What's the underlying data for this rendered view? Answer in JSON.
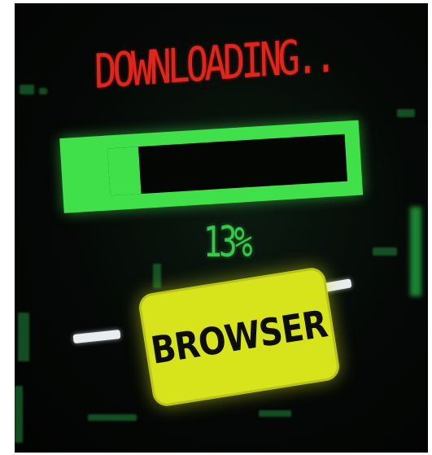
{
  "title": "DOWNLOADING..",
  "progress": {
    "fraction": 0.13,
    "label": "13%"
  },
  "button": {
    "label": "BROWSER"
  },
  "colors": {
    "title": "#e1251b",
    "progress_bar": "#3fe04a",
    "percent_text": "#35c94a",
    "button_bg": "#d7e41b",
    "button_text": "#0d0d0a",
    "background": "#050806"
  }
}
